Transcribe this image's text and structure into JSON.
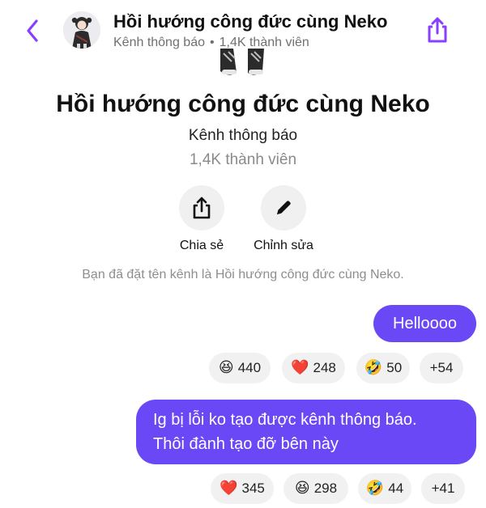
{
  "header": {
    "title": "Hồi hướng công đức cùng Neko",
    "subtitle_type": "Kênh thông báo",
    "subtitle_separator": "•",
    "subtitle_members": "1,4K thành viên"
  },
  "channel": {
    "name": "Hồi hướng công đức cùng Neko",
    "type": "Kênh thông báo",
    "members": "1,4K thành viên"
  },
  "actions": {
    "share_label": "Chia sẻ",
    "edit_label": "Chỉnh sửa"
  },
  "notice": "Bạn đã đặt tên kênh là Hồi hướng công đức cùng Neko.",
  "messages": [
    {
      "text_lines": [
        "Helloooo"
      ],
      "reactions": [
        {
          "emoji": "😆",
          "count": "440"
        },
        {
          "emoji": "❤️",
          "count": "248"
        },
        {
          "emoji": "🤣",
          "count": "50"
        },
        {
          "emoji": "",
          "count": "+54"
        }
      ]
    },
    {
      "text_lines": [
        "Ig bị lỗi ko tạo được kênh thông báo.",
        "Thôi đành tạo đỡ bên này"
      ],
      "reactions": [
        {
          "emoji": "❤️",
          "count": "345"
        },
        {
          "emoji": "😆",
          "count": "298"
        },
        {
          "emoji": "🤣",
          "count": "44"
        },
        {
          "emoji": "",
          "count": "+41"
        }
      ]
    }
  ],
  "colors": {
    "accent": "#8a3ffc",
    "bubble": "#6a48f5",
    "pill": "#f1f1f1",
    "muted_text": "#8e8e8e"
  },
  "icons": {
    "back": "chevron-left-icon",
    "share_top": "share-icon",
    "share_action": "share-icon",
    "edit_action": "pencil-icon"
  }
}
